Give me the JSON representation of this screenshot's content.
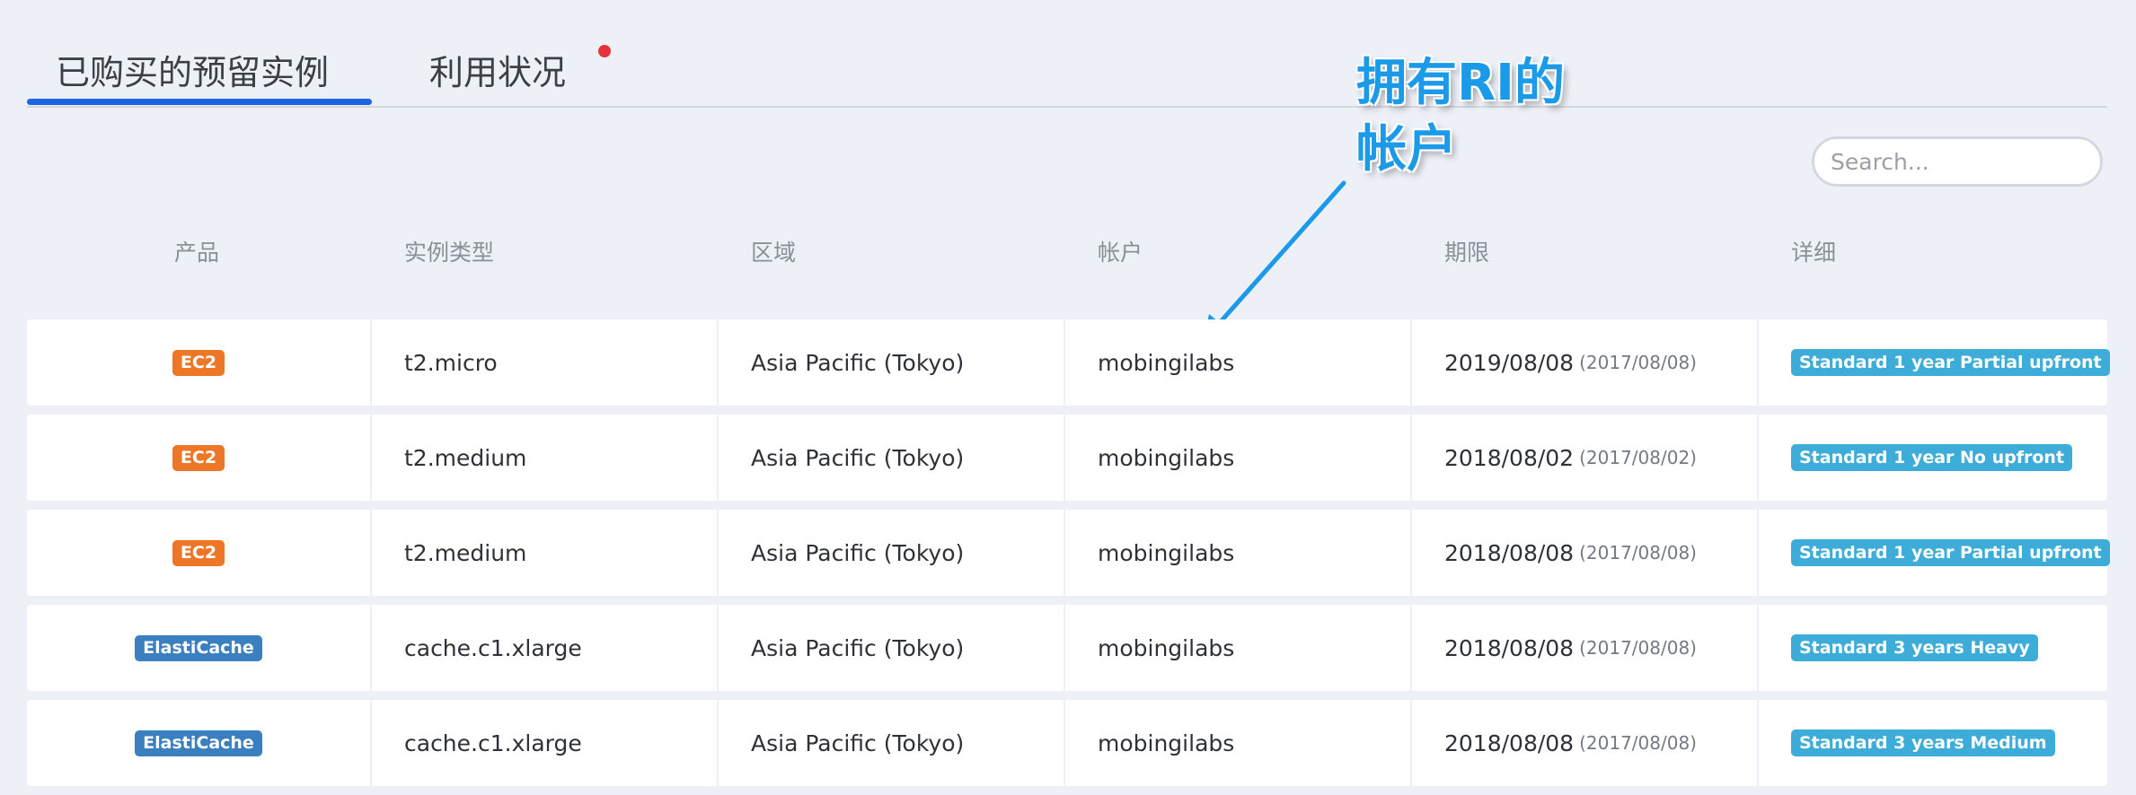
{
  "tabs": [
    {
      "label": "已购买的预留实例",
      "active": true
    },
    {
      "label": "利用状况",
      "has_notification": true
    }
  ],
  "annotation": {
    "line1": "拥有RI的",
    "line2": "帐户"
  },
  "search": {
    "placeholder": "Search..."
  },
  "columns": [
    "产品",
    "实例类型",
    "区域",
    "帐户",
    "期限",
    "详细"
  ],
  "rows": [
    {
      "product": "EC2",
      "product_kind": "ec2",
      "instance_type": "t2.micro",
      "region": "Asia Pacific (Tokyo)",
      "account": "mobingilabs",
      "expiry": "2019/08/08",
      "start": "(2017/08/08)",
      "detail": "Standard 1 year Partial upfront"
    },
    {
      "product": "EC2",
      "product_kind": "ec2",
      "instance_type": "t2.medium",
      "region": "Asia Pacific (Tokyo)",
      "account": "mobingilabs",
      "expiry": "2018/08/02",
      "start": "(2017/08/02)",
      "detail": "Standard 1 year No upfront"
    },
    {
      "product": "EC2",
      "product_kind": "ec2",
      "instance_type": "t2.medium",
      "region": "Asia Pacific (Tokyo)",
      "account": "mobingilabs",
      "expiry": "2018/08/08",
      "start": "(2017/08/08)",
      "detail": "Standard 1 year Partial upfront"
    },
    {
      "product": "ElastiCache",
      "product_kind": "ec",
      "instance_type": "cache.c1.xlarge",
      "region": "Asia Pacific (Tokyo)",
      "account": "mobingilabs",
      "expiry": "2018/08/08",
      "start": "(2017/08/08)",
      "detail": "Standard 3 years Heavy"
    },
    {
      "product": "ElastiCache",
      "product_kind": "ec",
      "instance_type": "cache.c1.xlarge",
      "region": "Asia Pacific (Tokyo)",
      "account": "mobingilabs",
      "expiry": "2018/08/08",
      "start": "(2017/08/08)",
      "detail": "Standard 3 years Medium"
    }
  ],
  "colors": {
    "accent": "#1d63e6",
    "ec2_badge": "#ee7627",
    "elasticache_badge": "#3a7fbf",
    "detail_badge": "#3dacd9",
    "annotation": "#1a9ae8",
    "notification_dot": "#e5333b"
  }
}
